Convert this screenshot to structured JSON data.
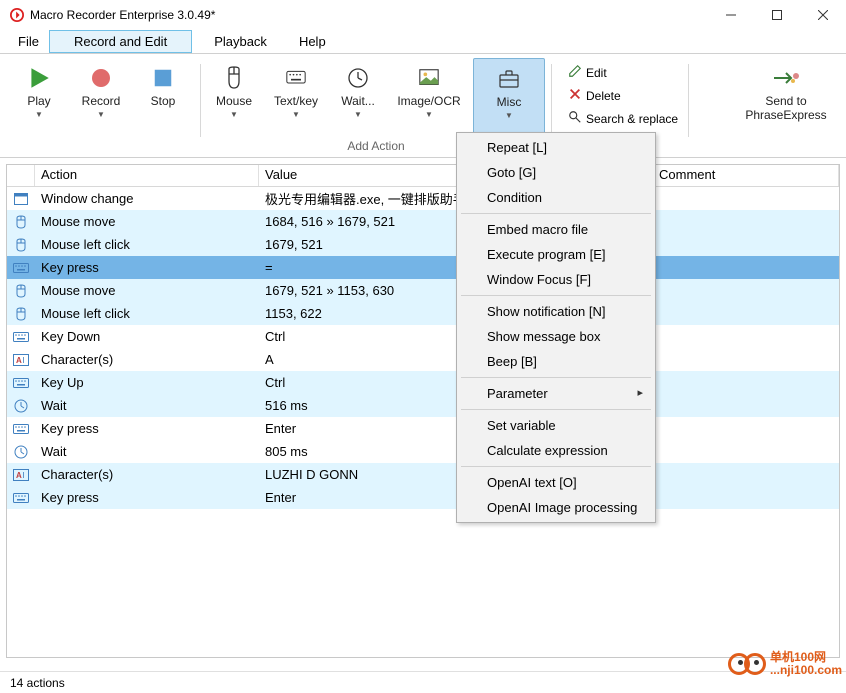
{
  "title": "Macro Recorder Enterprise 3.0.49*",
  "menubar": [
    "File",
    "Record and Edit",
    "Playback",
    "Help"
  ],
  "ribbon": {
    "play": "Play",
    "record": "Record",
    "stop": "Stop",
    "mouse": "Mouse",
    "textkey": "Text/key",
    "wait": "Wait...",
    "imageocr": "Image/OCR",
    "misc": "Misc",
    "edit": "Edit",
    "delete": "Delete",
    "search": "Search & replace",
    "sendto": "Send to",
    "phraseexpress": "PhraseExpress",
    "group_add_action": "Add Action"
  },
  "columns": {
    "action": "Action",
    "value": "Value",
    "comment": "Comment"
  },
  "rows": [
    {
      "icon": "window",
      "action": "Window change",
      "value": "极光专用编辑器.exe, 一键排版助手"
    },
    {
      "icon": "mouse",
      "action": "Mouse move",
      "value": "1684, 516 » 1679, 521"
    },
    {
      "icon": "mouse",
      "action": "Mouse left click",
      "value": "1679, 521"
    },
    {
      "icon": "keyboard",
      "action": "Key press",
      "value": "="
    },
    {
      "icon": "mouse",
      "action": "Mouse move",
      "value": "1679, 521 » 1153, 630"
    },
    {
      "icon": "mouse",
      "action": "Mouse left click",
      "value": "1153, 622"
    },
    {
      "icon": "keyboard",
      "action": "Key Down",
      "value": "Ctrl"
    },
    {
      "icon": "char",
      "action": "Character(s)",
      "value": "A"
    },
    {
      "icon": "keyboard",
      "action": "Key Up",
      "value": "Ctrl"
    },
    {
      "icon": "wait",
      "action": "Wait",
      "value": "516 ms"
    },
    {
      "icon": "keyboard",
      "action": "Key press",
      "value": "Enter"
    },
    {
      "icon": "wait",
      "action": "Wait",
      "value": "805 ms"
    },
    {
      "icon": "char",
      "action": "Character(s)",
      "value": "LUZHI D GONN"
    },
    {
      "icon": "keyboard",
      "action": "Key press",
      "value": "Enter"
    }
  ],
  "blue_indices": [
    1,
    2,
    3,
    4,
    5,
    8,
    9,
    12,
    13
  ],
  "selected_index": 3,
  "dropdown": {
    "groups": [
      [
        "Repeat [L]",
        "Goto [G]",
        "Condition"
      ],
      [
        "Embed macro file",
        "Execute program [E]",
        "Window Focus [F]"
      ],
      [
        "Show notification [N]",
        "Show message box",
        "Beep [B]"
      ],
      [
        "Parameter"
      ],
      [
        "Set variable",
        "Calculate expression"
      ],
      [
        "OpenAI text [O]",
        "OpenAI Image processing"
      ]
    ],
    "submenu_items": [
      "Parameter"
    ]
  },
  "status": "14 actions",
  "watermark": {
    "line1": "单机100网",
    "line2": "...nji100.com"
  }
}
